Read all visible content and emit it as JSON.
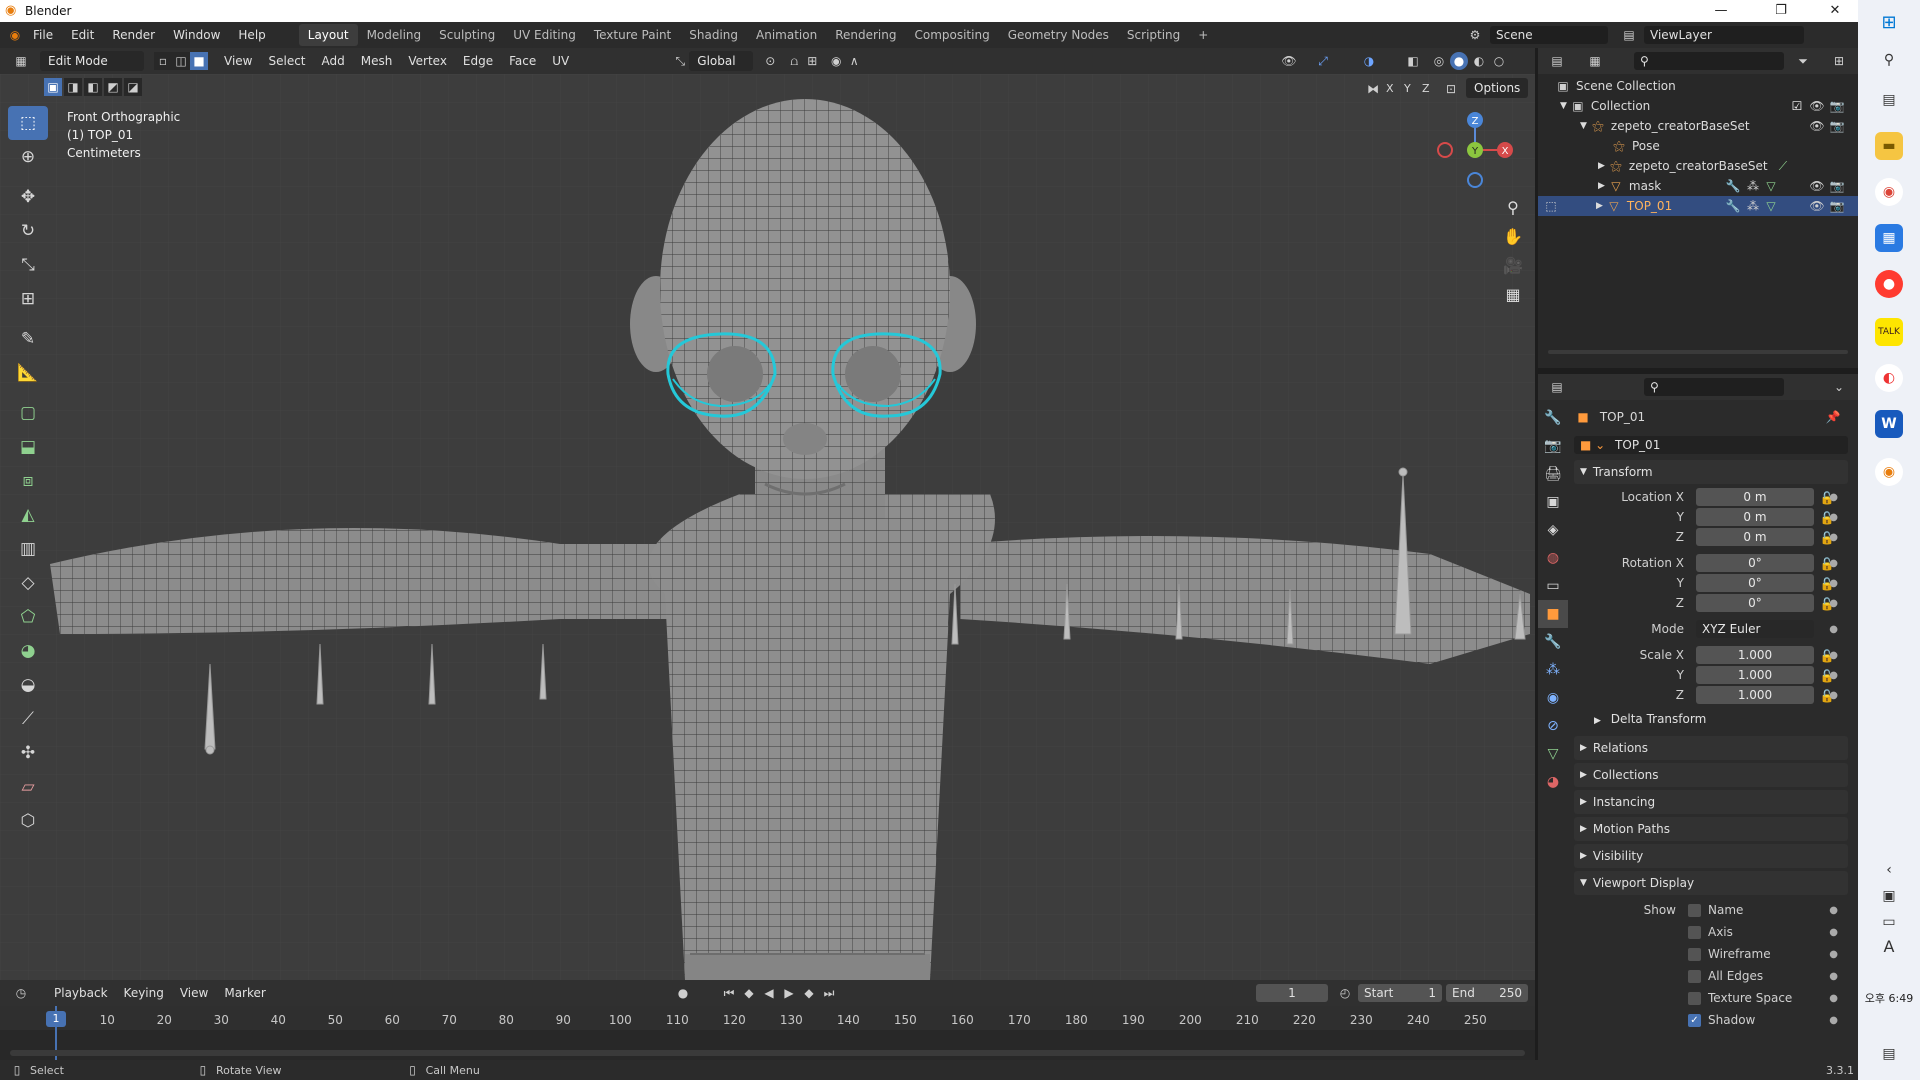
{
  "window": {
    "title": "Blender",
    "minimize": "—",
    "restore": "❐",
    "close": "✕"
  },
  "menu": [
    "File",
    "Edit",
    "Render",
    "Window",
    "Help"
  ],
  "workspaces": [
    {
      "label": "Layout",
      "active": true
    },
    {
      "label": "Modeling",
      "active": false
    },
    {
      "label": "Sculpting",
      "active": false
    },
    {
      "label": "UV Editing",
      "active": false
    },
    {
      "label": "Texture Paint",
      "active": false
    },
    {
      "label": "Shading",
      "active": false
    },
    {
      "label": "Animation",
      "active": false
    },
    {
      "label": "Rendering",
      "active": false
    },
    {
      "label": "Compositing",
      "active": false
    },
    {
      "label": "Geometry Nodes",
      "active": false
    },
    {
      "label": "Scripting",
      "active": false
    }
  ],
  "add_workspace": "+",
  "scene": {
    "label": "Scene",
    "view_layer": "ViewLayer"
  },
  "viewport_header": {
    "mode": "Edit Mode",
    "menus": [
      "View",
      "Select",
      "Add",
      "Mesh",
      "Vertex",
      "Edge",
      "Face",
      "UV"
    ],
    "orientation": "Global",
    "options": "Options",
    "axes": [
      "X",
      "Y",
      "Z"
    ]
  },
  "viewport_info": {
    "line1": "Front Orthographic",
    "line2": "(1) TOP_01",
    "line3": "Centimeters"
  },
  "gizmo": {
    "z": "Z",
    "y": "Y",
    "x": "X"
  },
  "tools": [
    "select-box",
    "cursor",
    "move",
    "rotate",
    "scale",
    "transform",
    "annotate",
    "measure",
    "add-cube",
    "extrude",
    "inset",
    "bevel",
    "loop-cut",
    "knife",
    "poly-build",
    "spin",
    "smooth",
    "edge-slide",
    "shrink-fatten",
    "shear",
    "rip"
  ],
  "timeline": {
    "menus": [
      "Playback",
      "Keying",
      "View",
      "Marker"
    ],
    "current_frame": "1",
    "start_label": "Start",
    "start": "1",
    "end_label": "End",
    "end": "250",
    "ticks": [
      "1",
      "10",
      "20",
      "30",
      "40",
      "50",
      "60",
      "70",
      "80",
      "90",
      "100",
      "110",
      "120",
      "130",
      "140",
      "150",
      "160",
      "170",
      "180",
      "190",
      "200",
      "210",
      "220",
      "230",
      "240",
      "250"
    ]
  },
  "status": {
    "select": "Select",
    "rotate": "Rotate View",
    "menu": "Call Menu",
    "version": "3.3.1"
  },
  "outliner": {
    "root": "Scene Collection",
    "collection": "Collection",
    "items": [
      {
        "name": "zepeto_creatorBaseSet",
        "depth": 2
      },
      {
        "name": "Pose",
        "depth": 3
      },
      {
        "name": "zepeto_creatorBaseSet",
        "depth": 3
      },
      {
        "name": "mask",
        "depth": 3
      },
      {
        "name": "TOP_01",
        "depth": 3,
        "selected": true
      }
    ]
  },
  "properties": {
    "object_name": "TOP_01",
    "data_name": "TOP_01",
    "transform_title": "Transform",
    "location": {
      "label": "Location X",
      "x": "0 m",
      "y": "0 m",
      "z": "0 m"
    },
    "rotation": {
      "label": "Rotation X",
      "x": "0°",
      "y": "0°",
      "z": "0°"
    },
    "mode_label": "Mode",
    "mode": "XYZ Euler",
    "scale": {
      "label": "Scale X",
      "x": "1.000",
      "y": "1.000",
      "z": "1.000"
    },
    "axis_y": "Y",
    "axis_z": "Z",
    "delta": "Delta Transform",
    "panels": [
      "Relations",
      "Collections",
      "Instancing",
      "Motion Paths",
      "Visibility"
    ],
    "viewport_display": "Viewport Display",
    "show_label": "Show",
    "show": [
      {
        "label": "Name",
        "on": false
      },
      {
        "label": "Axis",
        "on": false
      },
      {
        "label": "Wireframe",
        "on": false
      },
      {
        "label": "All Edges",
        "on": false
      },
      {
        "label": "Texture Space",
        "on": false
      },
      {
        "label": "Shadow",
        "on": true
      }
    ]
  },
  "taskbar": {
    "time": "오후 6:49",
    "lang": "A"
  },
  "colors": {
    "accent": "#4772b3",
    "selection": "#334d80",
    "viewport_bg": "#3d3d3d",
    "edge_select": "#25c8d8"
  }
}
